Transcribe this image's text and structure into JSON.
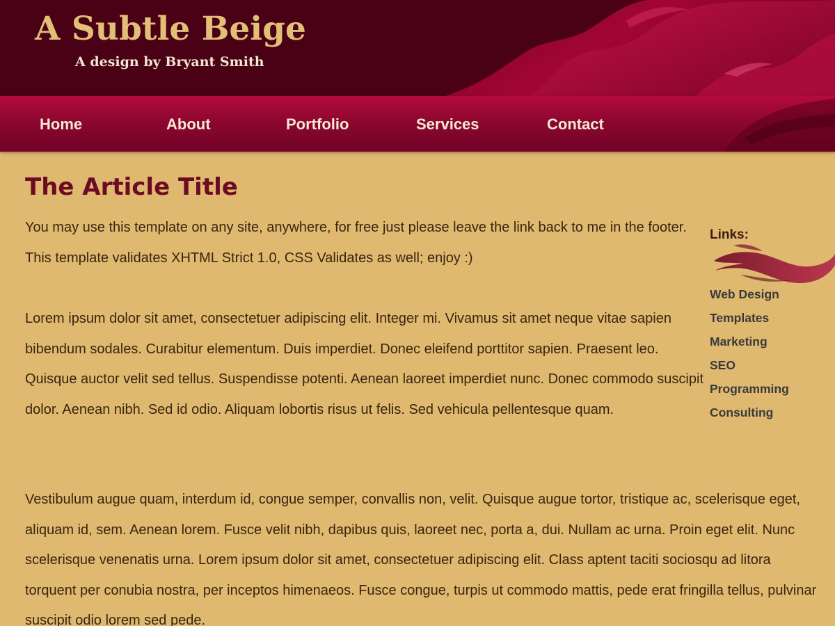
{
  "header": {
    "title": "A Subtle Beige",
    "subtitle": "A design by Bryant Smith"
  },
  "nav": {
    "items": [
      {
        "label": "Home"
      },
      {
        "label": "About"
      },
      {
        "label": "Portfolio"
      },
      {
        "label": "Services"
      },
      {
        "label": "Contact"
      }
    ]
  },
  "article": {
    "title": "The Article Title",
    "paragraphs": [
      "You may use this template on any site, anywhere, for free just please leave the link back to me in the footer. This template validates XHTML Strict 1.0, CSS Validates as well; enjoy :)",
      "Lorem ipsum dolor sit amet, consectetuer adipiscing elit. Integer mi. Vivamus sit amet neque vitae sapien bibendum sodales. Curabitur elementum. Duis imperdiet. Donec eleifend porttitor sapien. Praesent leo. Quisque auctor velit sed tellus. Suspendisse potenti. Aenean laoreet imperdiet nunc. Donec commodo suscipit dolor. Aenean nibh. Sed id odio. Aliquam lobortis risus ut felis. Sed vehicula pellentesque quam.",
      "Vestibulum augue quam, interdum id, congue semper, convallis non, velit. Quisque augue tortor, tristique ac, scelerisque eget, aliquam id, sem. Aenean lorem. Fusce velit nibh, dapibus quis, laoreet nec, porta a, dui. Nullam ac urna. Proin eget elit. Nunc scelerisque venenatis urna. Lorem ipsum dolor sit amet, consectetuer adipiscing elit. Class aptent taciti sociosqu ad litora torquent per conubia nostra, per inceptos himenaeos. Fusce congue, turpis ut commodo mattis, pede erat fringilla tellus, pulvinar suscipit odio lorem sed pede."
    ]
  },
  "sidebar": {
    "heading": "Links:",
    "decoration_icon": "feather-swoosh-icon",
    "links": [
      {
        "label": "Web Design"
      },
      {
        "label": "Templates"
      },
      {
        "label": "Marketing"
      },
      {
        "label": "SEO"
      },
      {
        "label": "Programming"
      },
      {
        "label": "Consulting"
      }
    ]
  },
  "colors": {
    "page_background": "#dfb96f",
    "header_background": "#4a0015",
    "nav_background": "#8c0730",
    "title_gold": "#e2bf77",
    "article_title": "#6e0b24",
    "body_text": "#3a2410"
  }
}
